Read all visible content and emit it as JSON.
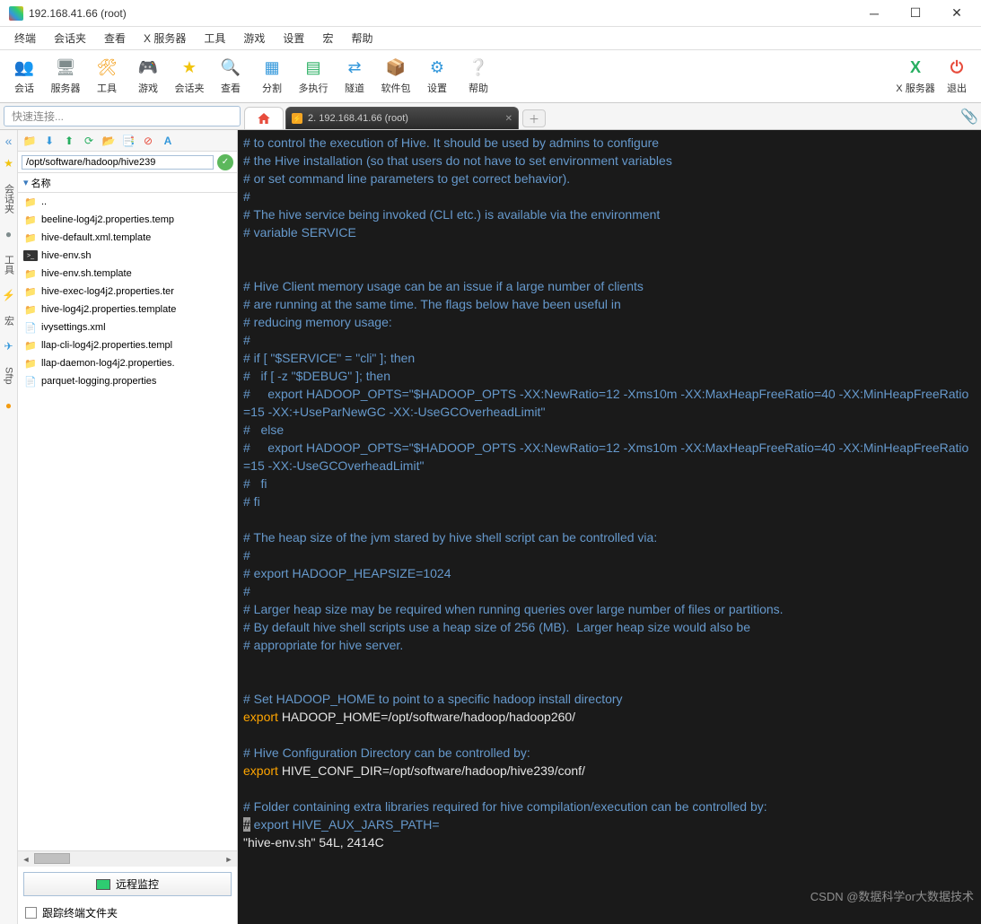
{
  "window": {
    "title": "192.168.41.66 (root)"
  },
  "menubar": [
    "终端",
    "会话夹",
    "查看",
    "X 服务器",
    "工具",
    "游戏",
    "设置",
    "宏",
    "帮助"
  ],
  "toolbar": {
    "items": [
      {
        "label": "会话",
        "icon": "👥",
        "cls": "ic-blue"
      },
      {
        "label": "服务器",
        "icon": "🖥",
        "cls": "ic-gray"
      },
      {
        "label": "工具",
        "icon": "🛠",
        "cls": "ic-orange"
      },
      {
        "label": "游戏",
        "icon": "🎮",
        "cls": "ic-purple"
      },
      {
        "label": "会话夹",
        "icon": "★",
        "cls": "ic-yellow"
      },
      {
        "label": "查看",
        "icon": "🔍",
        "cls": "ic-gray"
      },
      {
        "label": "分割",
        "icon": "▦",
        "cls": "ic-blue"
      },
      {
        "label": "多执行",
        "icon": "▤",
        "cls": "ic-green"
      },
      {
        "label": "隧道",
        "icon": "⇄",
        "cls": "ic-blue"
      },
      {
        "label": "软件包",
        "icon": "📦",
        "cls": "ic-orange"
      },
      {
        "label": "设置",
        "icon": "⚙",
        "cls": "ic-blue"
      },
      {
        "label": "帮助",
        "icon": "❔",
        "cls": "ic-blue"
      }
    ],
    "right": [
      {
        "label": "X 服务器",
        "icon": "X",
        "cls": "ic-green"
      },
      {
        "label": "退出",
        "icon": "⏻",
        "cls": "ic-red"
      }
    ]
  },
  "quick": {
    "placeholder": "快速连接..."
  },
  "tabs": {
    "terminal": "2. 192.168.41.66 (root)"
  },
  "vrail": [
    "会话夹",
    "工具",
    "宏",
    "Sftp"
  ],
  "sidebar": {
    "path": "/opt/software/hadoop/hive239",
    "header": "名称",
    "files": [
      {
        "name": "..",
        "type": "folder"
      },
      {
        "name": "beeline-log4j2.properties.temp",
        "type": "folder"
      },
      {
        "name": "hive-default.xml.template",
        "type": "folder"
      },
      {
        "name": "hive-env.sh",
        "type": "sh"
      },
      {
        "name": "hive-env.sh.template",
        "type": "folder"
      },
      {
        "name": "hive-exec-log4j2.properties.ter",
        "type": "folder"
      },
      {
        "name": "hive-log4j2.properties.template",
        "type": "folder"
      },
      {
        "name": "ivysettings.xml",
        "type": "file"
      },
      {
        "name": "llap-cli-log4j2.properties.templ",
        "type": "folder"
      },
      {
        "name": "llap-daemon-log4j2.properties.",
        "type": "folder"
      },
      {
        "name": "parquet-logging.properties",
        "type": "file"
      }
    ],
    "remote_btn": "远程监控",
    "track_label": "跟踪终端文件夹"
  },
  "terminal": {
    "lines": [
      {
        "t": "comment",
        "text": "# to control the execution of Hive. It should be used by admins to configure"
      },
      {
        "t": "comment",
        "text": "# the Hive installation (so that users do not have to set environment variables"
      },
      {
        "t": "comment",
        "text": "# or set command line parameters to get correct behavior)."
      },
      {
        "t": "comment",
        "text": "#"
      },
      {
        "t": "comment",
        "text": "# The hive service being invoked (CLI etc.) is available via the environment"
      },
      {
        "t": "comment",
        "text": "# variable SERVICE"
      },
      {
        "t": "blank",
        "text": ""
      },
      {
        "t": "blank",
        "text": ""
      },
      {
        "t": "comment",
        "text": "# Hive Client memory usage can be an issue if a large number of clients"
      },
      {
        "t": "comment",
        "text": "# are running at the same time. The flags below have been useful in"
      },
      {
        "t": "comment",
        "text": "# reducing memory usage:"
      },
      {
        "t": "comment",
        "text": "#"
      },
      {
        "t": "comment",
        "text": "# if [ \"$SERVICE\" = \"cli\" ]; then"
      },
      {
        "t": "comment",
        "text": "#   if [ -z \"$DEBUG\" ]; then"
      },
      {
        "t": "comment",
        "text": "#     export HADOOP_OPTS=\"$HADOOP_OPTS -XX:NewRatio=12 -Xms10m -XX:MaxHeapFreeRatio=40 -XX:MinHeapFreeRatio=15 -XX:+UseParNewGC -XX:-UseGCOverheadLimit\""
      },
      {
        "t": "comment",
        "text": "#   else"
      },
      {
        "t": "comment",
        "text": "#     export HADOOP_OPTS=\"$HADOOP_OPTS -XX:NewRatio=12 -Xms10m -XX:MaxHeapFreeRatio=40 -XX:MinHeapFreeRatio=15 -XX:-UseGCOverheadLimit\""
      },
      {
        "t": "comment",
        "text": "#   fi"
      },
      {
        "t": "comment",
        "text": "# fi"
      },
      {
        "t": "blank",
        "text": ""
      },
      {
        "t": "comment",
        "text": "# The heap size of the jvm stared by hive shell script can be controlled via:"
      },
      {
        "t": "comment",
        "text": "#"
      },
      {
        "t": "comment",
        "text": "# export HADOOP_HEAPSIZE=1024"
      },
      {
        "t": "comment",
        "text": "#"
      },
      {
        "t": "comment",
        "text": "# Larger heap size may be required when running queries over large number of files or partitions."
      },
      {
        "t": "comment",
        "text": "# By default hive shell scripts use a heap size of 256 (MB).  Larger heap size would also be"
      },
      {
        "t": "comment",
        "text": "# appropriate for hive server."
      },
      {
        "t": "blank",
        "text": ""
      },
      {
        "t": "blank",
        "text": ""
      },
      {
        "t": "comment",
        "text": "# Set HADOOP_HOME to point to a specific hadoop install directory"
      },
      {
        "t": "export",
        "key": "HADOOP_HOME",
        "val": "/opt/software/hadoop/hadoop260/"
      },
      {
        "t": "blank",
        "text": ""
      },
      {
        "t": "comment",
        "text": "# Hive Configuration Directory can be controlled by:"
      },
      {
        "t": "export",
        "key": "HIVE_CONF_DIR",
        "val": "/opt/software/hadoop/hive239/conf/"
      },
      {
        "t": "blank",
        "text": ""
      },
      {
        "t": "comment",
        "text": "# Folder containing extra libraries required for hive compilation/execution can be controlled by:"
      },
      {
        "t": "comment-bar",
        "text": "# export HIVE_AUX_JARS_PATH="
      },
      {
        "t": "status",
        "text": "\"hive-env.sh\" 54L, 2414C"
      }
    ],
    "watermark": "CSDN @数据科学or大数据技术"
  }
}
